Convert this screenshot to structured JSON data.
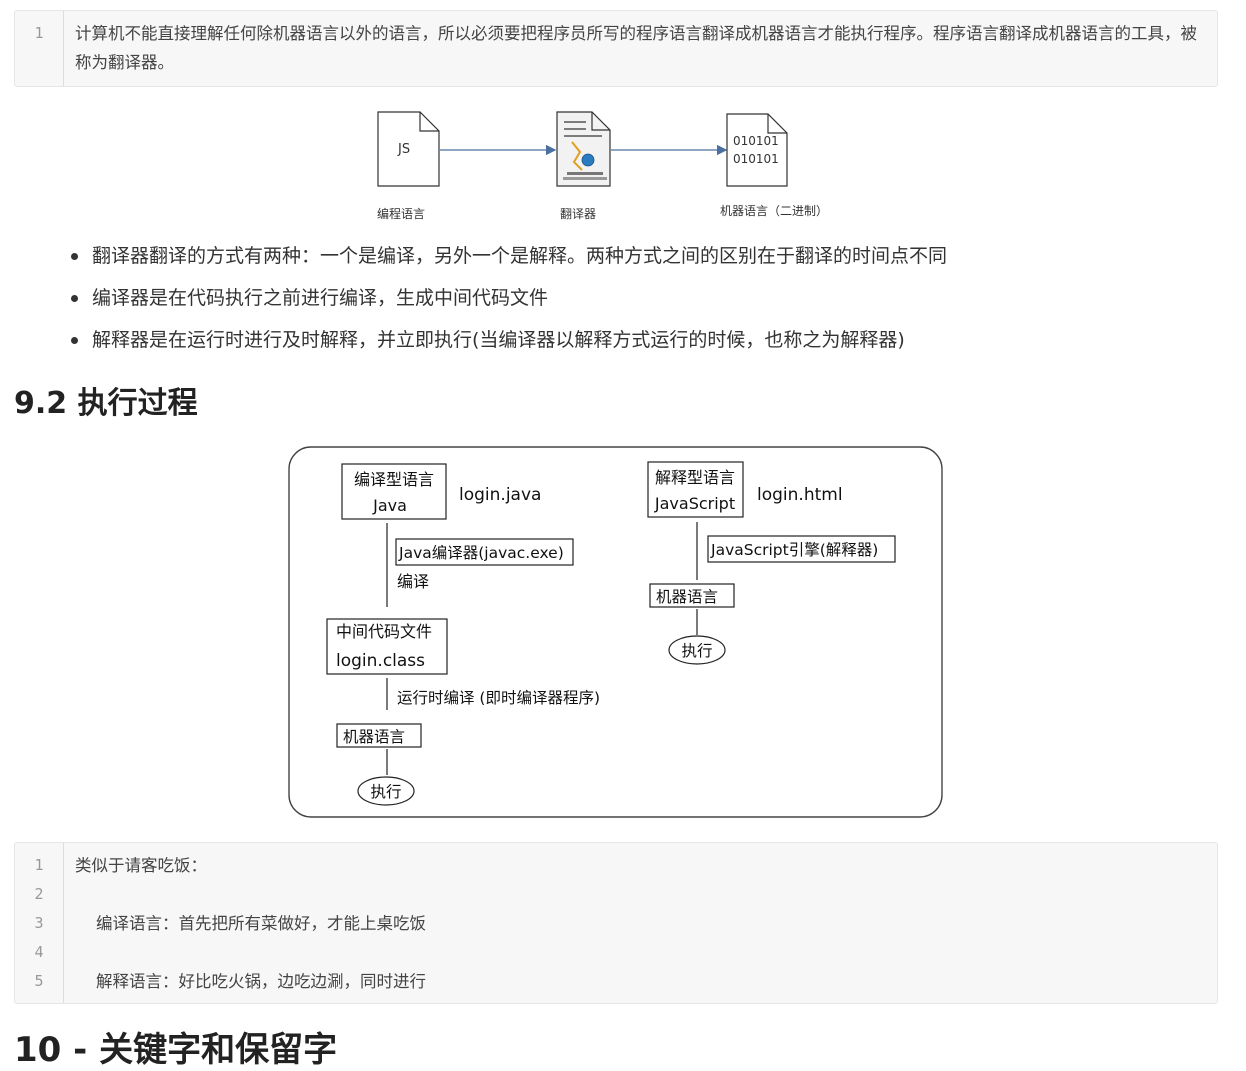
{
  "code_block_1": {
    "lines": [
      {
        "num": "1",
        "text": "计算机不能直接理解任何除机器语言以外的语言，所以必须要把程序员所写的程序语言翻译成机器语言才能执行程序。程序语言翻译成机器语言的工具，被称为翻译器。"
      }
    ]
  },
  "translator_figure": {
    "js_file_text": "JS",
    "binary_line_1": "010101",
    "binary_line_2": "010101",
    "label_source": "编程语言",
    "label_translator": "翻译器",
    "label_machine": "机器语言（二进制）"
  },
  "bullets": [
    "翻译器翻译的方式有两种：一个是编译，另外一个是解释。两种方式之间的区别在于翻译的时间点不同",
    "编译器是在代码执行之前进行编译，生成中间代码文件",
    "解释器是在运行时进行及时解释，并立即执行(当编译器以解释方式运行的时候，也称之为解释器)"
  ],
  "section_9_2": {
    "heading": "9.2 执行过程"
  },
  "process_figure": {
    "compiled_line1": "编译型语言",
    "compiled_line2": "Java",
    "compiled_file": "login.java",
    "javac": "Java编译器(javac.exe)",
    "compile": "编译",
    "intermediate_line1": "中间代码文件",
    "intermediate_line2": "login.class",
    "jit": "运行时编译 (即时编译器程序)",
    "machine_left": "机器语言",
    "exec_left": "执行",
    "interp_line1": "解释型语言",
    "interp_line2": "JavaScript",
    "interp_file": "login.html",
    "js_engine": "JavaScript引擎(解释器)",
    "machine_right": "机器语言",
    "exec_right": "执行"
  },
  "code_block_2": {
    "lines": [
      {
        "num": "1",
        "text": "类似于请客吃饭："
      },
      {
        "num": "2",
        "text": ""
      },
      {
        "num": "3",
        "text": "    编译语言：首先把所有菜做好，才能上桌吃饭"
      },
      {
        "num": "4",
        "text": ""
      },
      {
        "num": "5",
        "text": "    解释语言：好比吃火锅，边吃边涮，同时进行"
      }
    ]
  },
  "section_10": {
    "heading": "10 - 关键字和保留字"
  }
}
